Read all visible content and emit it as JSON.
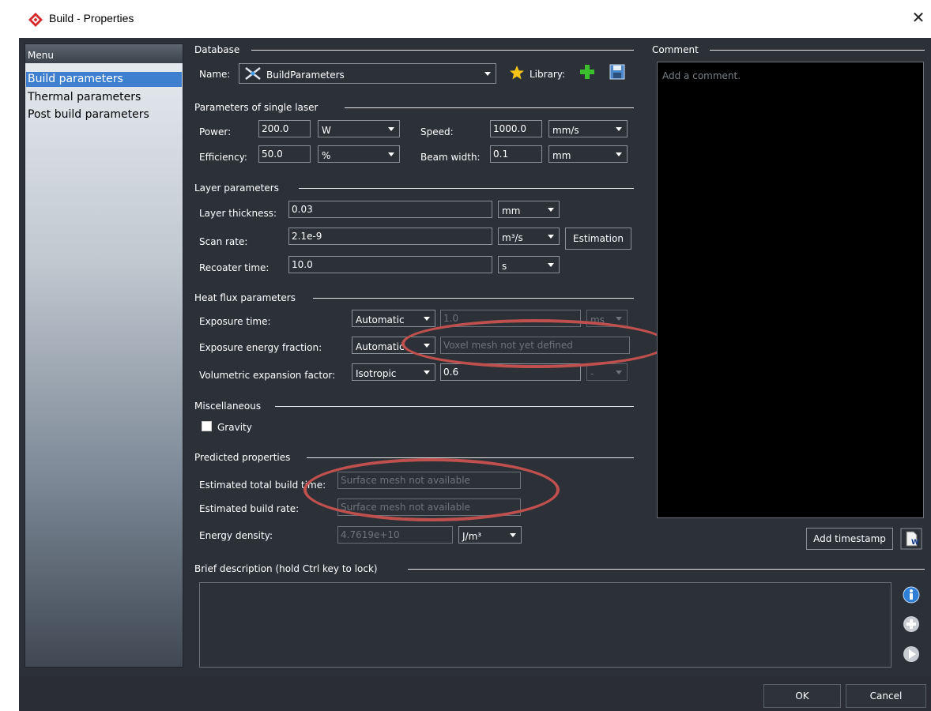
{
  "window": {
    "title": "Build - Properties",
    "close_glyph": "✕"
  },
  "menu": {
    "header": "Menu",
    "items": [
      {
        "label": "Build parameters",
        "selected": true
      },
      {
        "label": "Thermal parameters",
        "selected": false
      },
      {
        "label": "Post build parameters",
        "selected": false
      }
    ]
  },
  "database": {
    "heading": "Database",
    "name_label": "Name:",
    "name_value": "BuildParameters",
    "library_label": "Library:"
  },
  "single_laser": {
    "heading": "Parameters of single laser",
    "power_label": "Power:",
    "power_value": "200.0",
    "power_unit": "W",
    "speed_label": "Speed:",
    "speed_value": "1000.0",
    "speed_unit": "mm/s",
    "efficiency_label": "Efficiency:",
    "efficiency_value": "50.0",
    "efficiency_unit": "%",
    "beam_label": "Beam width:",
    "beam_value": "0.1",
    "beam_unit": "mm"
  },
  "layer": {
    "heading": "Layer parameters",
    "thickness_label": "Layer thickness:",
    "thickness_value": "0.03",
    "thickness_unit": "mm",
    "scan_label": "Scan rate:",
    "scan_value": "2.1e-9",
    "scan_unit": "m³/s",
    "estimation_button": "Estimation",
    "recoater_label": "Recoater time:",
    "recoater_value": "10.0",
    "recoater_unit": "s"
  },
  "heat_flux": {
    "heading": "Heat flux parameters",
    "exposure_time_label": "Exposure time:",
    "exposure_time_mode": "Automatic",
    "exposure_time_value": "1.0",
    "exposure_time_unit": "ms",
    "energy_fraction_label": "Exposure energy fraction:",
    "energy_fraction_mode": "Automatic",
    "energy_fraction_value": "Voxel mesh not yet defined",
    "expansion_label": "Volumetric expansion factor:",
    "expansion_mode": "Isotropic",
    "expansion_value": "0.6",
    "expansion_unit": "-"
  },
  "misc": {
    "heading": "Miscellaneous",
    "gravity_label": "Gravity"
  },
  "predicted": {
    "heading": "Predicted properties",
    "build_time_label": "Estimated total build time:",
    "build_time_value": "Surface mesh not available",
    "build_rate_label": "Estimated build rate:",
    "build_rate_value": "Surface mesh not available",
    "energy_label": "Energy density:",
    "energy_value": "4.7619e+10",
    "energy_unit": "J/m³"
  },
  "comment": {
    "heading": "Comment",
    "placeholder": "Add a comment.",
    "timestamp_button": "Add timestamp"
  },
  "brief": {
    "heading": "Brief description (hold Ctrl key to lock)"
  },
  "footer": {
    "ok": "OK",
    "cancel": "Cancel"
  },
  "colors": {
    "background": "#2c3138",
    "selection": "#3e7fcf",
    "annotation": "#c0504d"
  }
}
